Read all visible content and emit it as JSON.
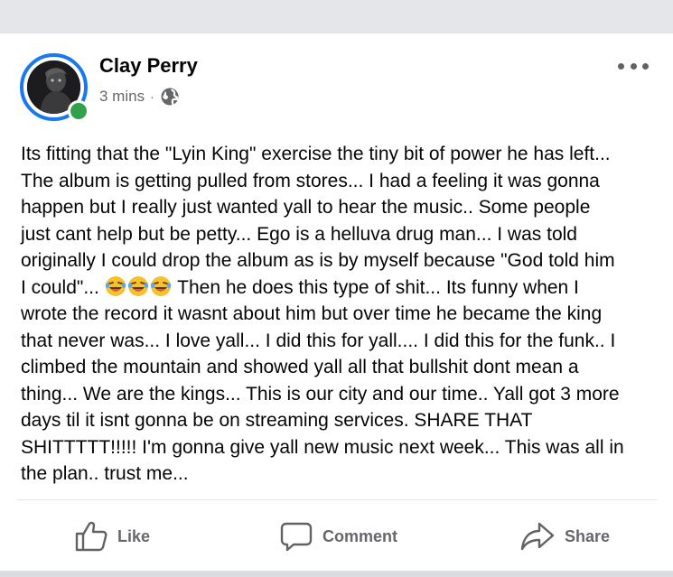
{
  "post": {
    "author": "Clay Perry",
    "time": "3 mins",
    "separator": "·",
    "privacy_icon": "globe-icon",
    "more_icon": "more-options-icon",
    "online": true,
    "text_lines": [
      "Its fitting that the \"Lyin King\" exercise the tiny bit of power he has left...",
      "The album is getting pulled from stores... I had a feeling it was gonna",
      "happen but I really just wanted yall to hear the music.. Some people",
      "just cant help but be petty... Ego is a helluva drug man... I was told",
      "originally I could drop the album as is by myself because \"God told him",
      "I could\"...",
      " Then he does this type of shit... Its funny when I",
      "wrote the record it wasnt about him but over time he became the king",
      "that never was...  I love yall... I did this for yall.... I did this for the funk.. I",
      "climbed the mountain and showed yall all that bullshit dont mean a",
      "thing... We are the kings... This is our city and our time.. Yall got 3 more",
      "days til it isnt gonna be on streaming services. SHARE THAT",
      "SHITTTTT!!!!! I'm gonna give yall new music next week... This was all in",
      "the plan.. trust me..."
    ],
    "emoji": [
      "laughing-tears-emoji",
      "laughing-tears-emoji",
      "laughing-tears-emoji"
    ]
  },
  "actions": {
    "like": "Like",
    "comment": "Comment",
    "share": "Share"
  },
  "colors": {
    "accent": "#1877f2",
    "online": "#31a24c",
    "secondary_text": "#65676b",
    "background_strip": "#e4e6ea"
  }
}
